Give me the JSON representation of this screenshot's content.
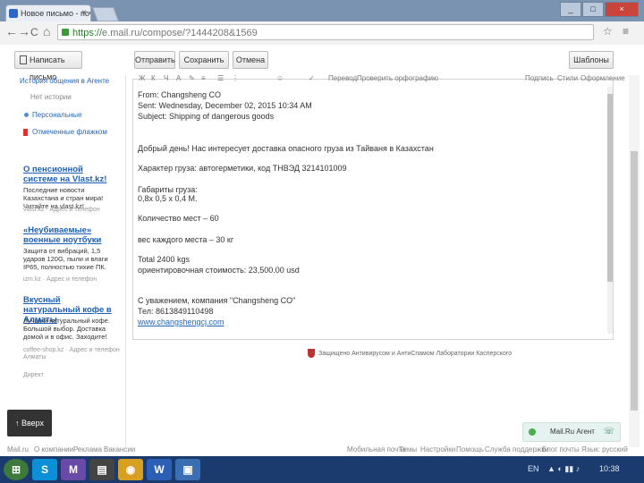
{
  "browser": {
    "tab_title": "Новое письмо - почта",
    "tab_close": "×",
    "window": {
      "min": "_",
      "max": "□",
      "close": "×"
    },
    "url_secure": "https://",
    "url_rest": "e.mail.ru/compose/?1444208&1569",
    "nav": {
      "back": "←",
      "fwd": "→",
      "reload": "C",
      "home": "⌂",
      "star": "☆",
      "menu": "≡"
    }
  },
  "toolbar": {
    "write_label": "Написать письмо",
    "send_label": "Отправить",
    "save_label": "Сохранить",
    "cancel_label": "Отмена",
    "templates_label": "Шаблоны"
  },
  "sidebar": {
    "history": "История общения в Агенте",
    "history_sub": "Нет истории",
    "personal": "Персональные",
    "flagged": "Отмеченные флажком",
    "ads": [
      {
        "title": "О пенсионной системе на Vlast.kz!",
        "text": "Последние новости Казахстана и стран мира! Читайте на vlast.kz!",
        "meta": "vlast.kz · Адрес и телефон"
      },
      {
        "title": "«Неубиваемые» военные ноутбуки",
        "text": "Защита от вибраций, 1,5 ударов 120G, пыли и влаги IP65, полностью тихие ПК.",
        "meta": "izm.kz · Адрес и телефон"
      },
      {
        "title": "Вкусный натуральный кофе в Алматы",
        "text": "Лучший натуральный кофе. Большой выбор. Доставка домой и в офис. Заходите!",
        "meta": "coffee-shop.kz · Адрес и телефон Алматы"
      }
    ],
    "direct": "Директ",
    "top_button": "↑ Вверх"
  },
  "message": {
    "from": "From: Changsheng CO",
    "sent": "Sent: Wednesday, December 02, 2015 10:34 AM",
    "subject": "Subject: Shipping of dangerous goods",
    "greeting": "Добрый день! Нас интересует доставка опасного груза из Тайваня в Казахстан",
    "cargo_char": "Характер груза: автогерметики, код ТНВЭД    3214101009",
    "dims_label": "Габариты груза:",
    "dims_value": "0,8х 0,5 х 0,4 М.",
    "places": "Количество мест – 60",
    "weight_each": "вес каждого места – 30 кг",
    "total": "Total 2400 kgs",
    "cost": "ориентировочная стоимость: 23,500.00 usd",
    "regards": "С уважением, компания \"Changsheng CO\"",
    "tel": "Тел: 8613849110498",
    "site": "www.changshengcj.com"
  },
  "editor_tools": [
    "Ж",
    "К",
    "Ч",
    "A",
    "✎",
    "≡",
    "☰",
    "⋮",
    "☺",
    "✓",
    "Перевод",
    "Проверить орфографию"
  ],
  "editor_right": [
    "Подпись",
    "Стили",
    "Оформление"
  ],
  "kaspersky": "Защищено Антивирусом и АнтиСпамом Лаборатории Касперского",
  "agent": {
    "label": "Mail.Ru Агент",
    "phone": "☏"
  },
  "footer_left": [
    "Mail.ru",
    "О компании",
    "Реклама",
    "Вакансии"
  ],
  "footer_right": [
    "Мобильная почта",
    "Темы",
    "Настройки",
    "Помощь",
    "Служба поддержки",
    "Блог почты",
    "Язык: русский"
  ],
  "taskbar": {
    "apps": [
      "⊞",
      "S",
      "M",
      "▤",
      "◉",
      "W",
      "▣"
    ],
    "lang": "EN",
    "time": "10:38"
  },
  "colors": {
    "accent": "#1c5fb8",
    "taskbar": "#1b3b6f"
  }
}
